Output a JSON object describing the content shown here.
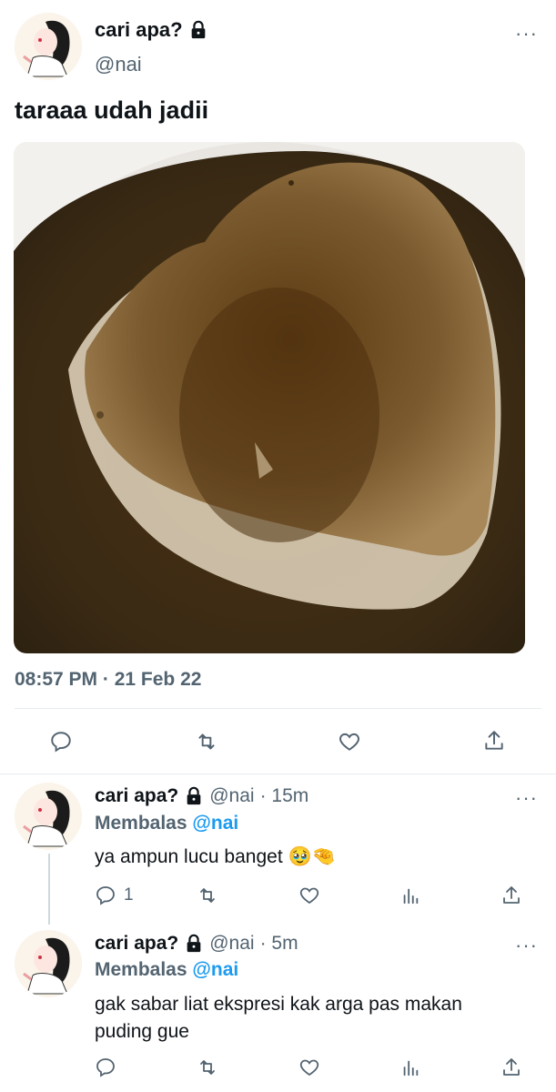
{
  "main_tweet": {
    "name": "cari apa?",
    "handle": "@nai",
    "text": "taraaa udah jadii",
    "timestamp": "08:57 PM · 21 Feb 22",
    "more": "···"
  },
  "main_actions": {
    "reply": "reply-icon",
    "retweet": "retweet-icon",
    "like": "heart-icon",
    "share": "share-icon"
  },
  "replies": [
    {
      "name": "cari apa?",
      "handle": "@nai",
      "time": "· 15m",
      "replying_prefix": "Membalas",
      "replying_to": "@nai",
      "text": "ya ampun lucu banget 🥹🤏",
      "reply_count": "1",
      "more": "···"
    },
    {
      "name": "cari apa?",
      "handle": "@nai",
      "time": "· 5m",
      "replying_prefix": "Membalas",
      "replying_to": "@nai",
      "text": "gak sabar liat ekspresi kak arga pas makan puding gue",
      "reply_count": "",
      "more": "···"
    }
  ],
  "colors": {
    "secondary_text": "#536471",
    "link": "#1d9bf0",
    "divider": "#e6ecf0"
  }
}
